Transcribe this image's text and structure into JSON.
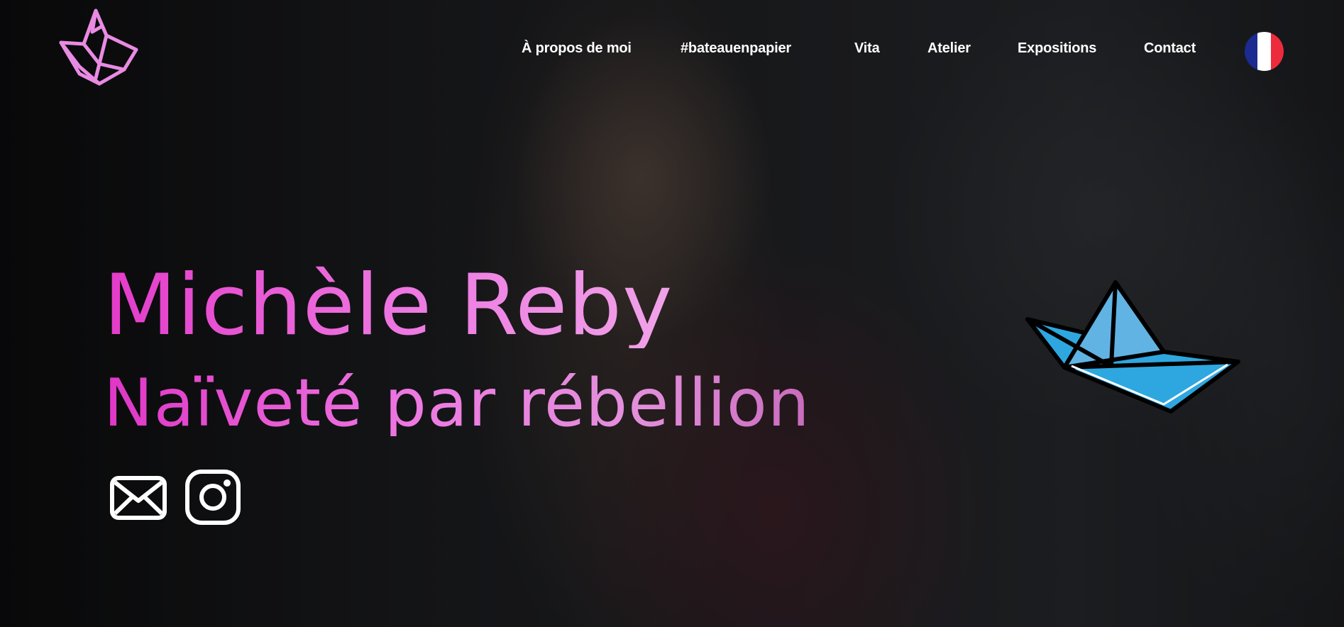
{
  "site": {
    "logo_icon": "paper-crown-logo",
    "accent_color": "#e95ad9",
    "accent_color_dark": "#df36c6"
  },
  "nav": {
    "items": [
      {
        "label": "À propos de moi"
      },
      {
        "label": "#bateauenpapier"
      },
      {
        "label": "Vita"
      },
      {
        "label": "Atelier"
      },
      {
        "label": "Expositions"
      },
      {
        "label": "Contact"
      }
    ],
    "language_icon": "french-flag-icon",
    "flag_colors": [
      "#1b2b8f",
      "#ffffff",
      "#ee2b3c"
    ]
  },
  "hero": {
    "title": "Michèle Reby",
    "subtitle": "Naïveté par rébellion",
    "social": [
      {
        "icon": "mail-icon"
      },
      {
        "icon": "instagram-icon"
      }
    ],
    "decoration_icon": "paper-boat-icon",
    "boat_color": "#2ea7e0"
  }
}
